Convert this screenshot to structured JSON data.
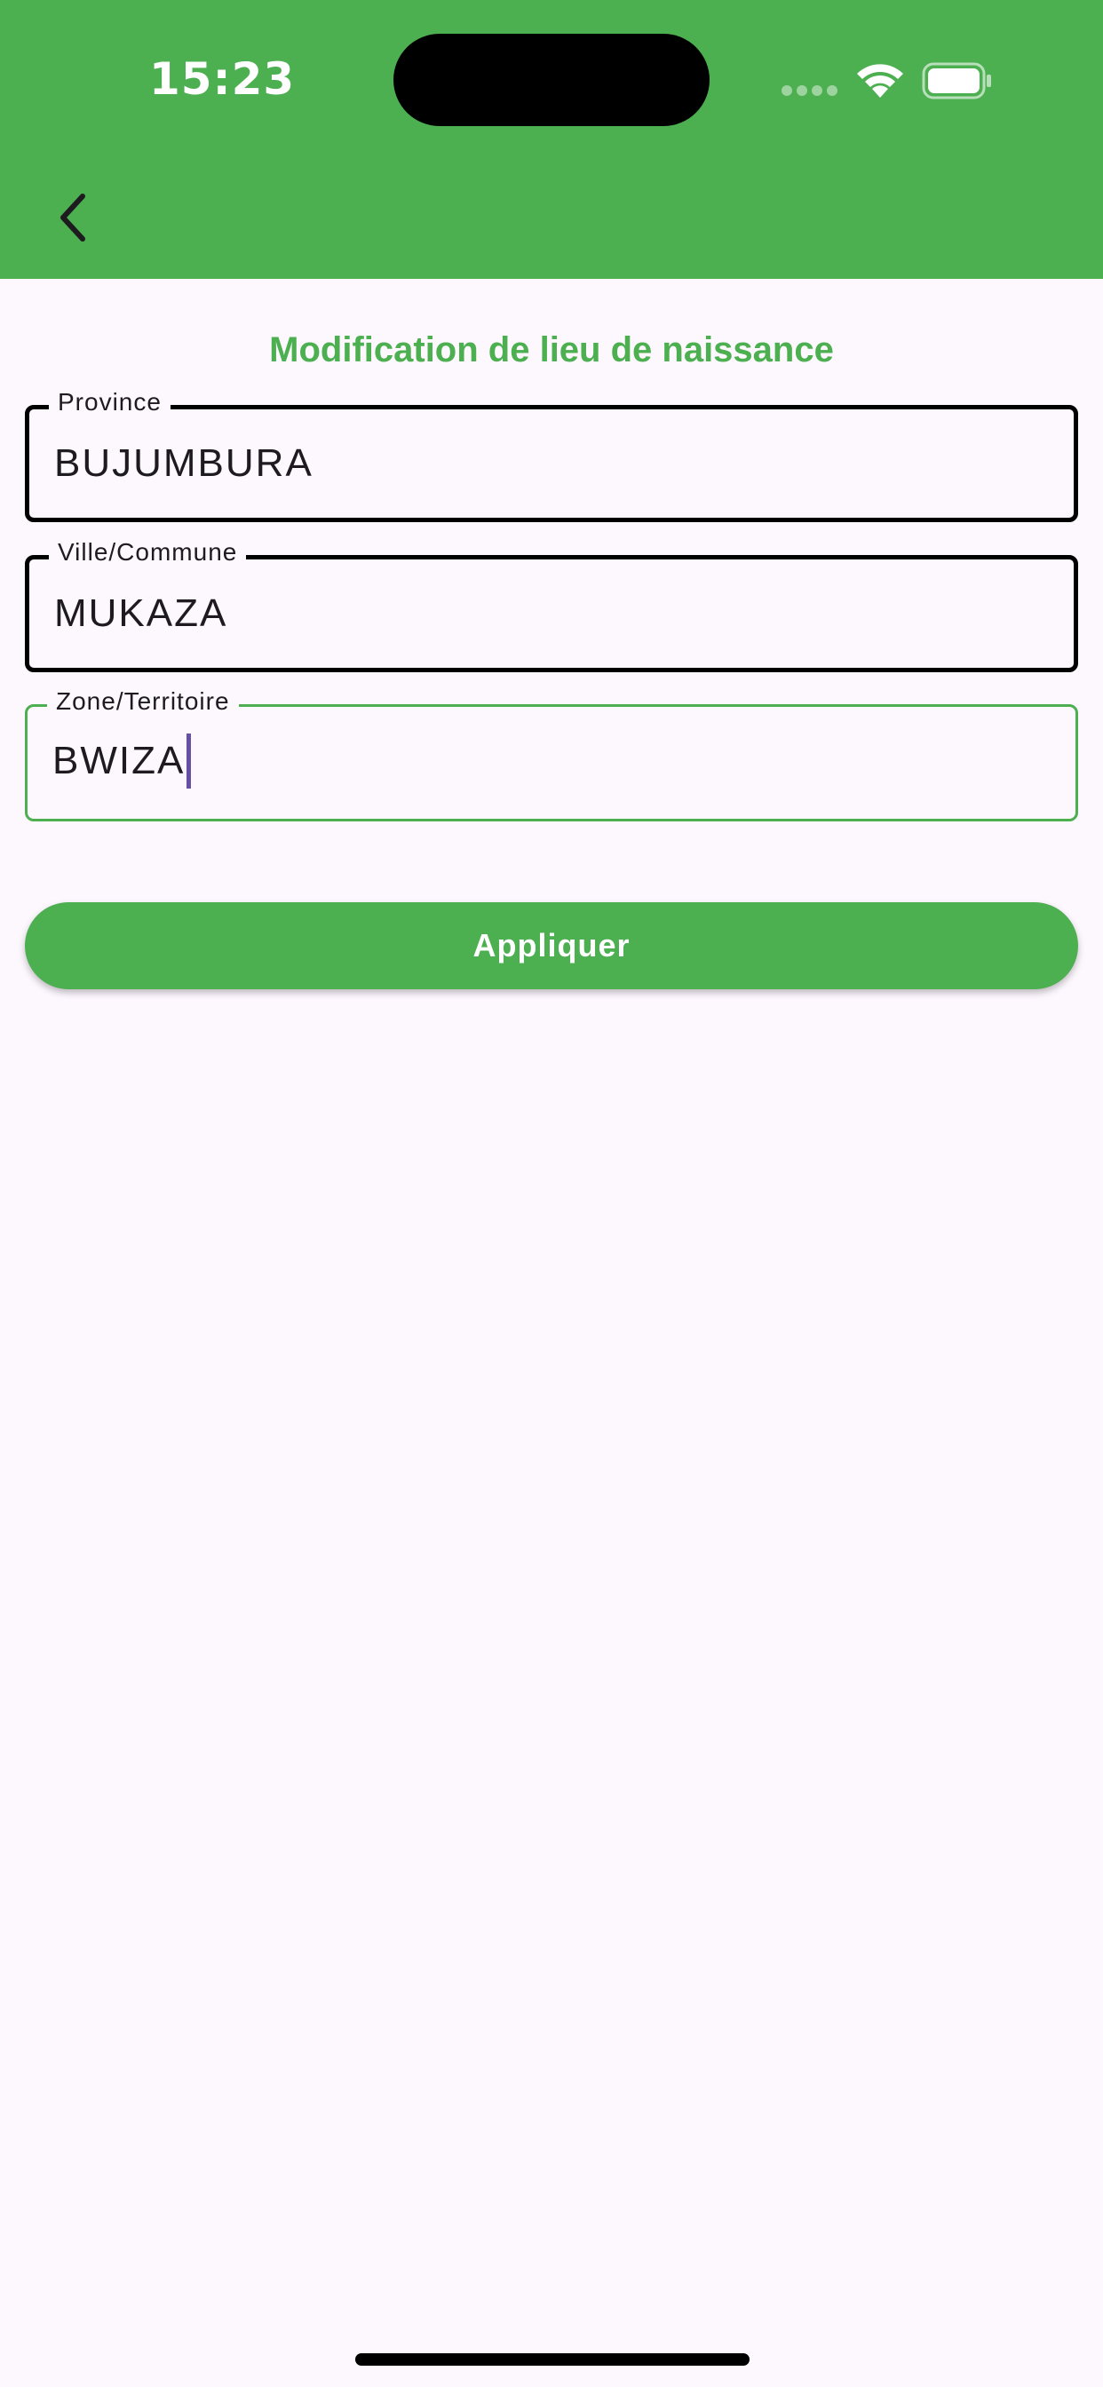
{
  "status_bar": {
    "time": "15:23"
  },
  "app_bar": {
    "background_color": "#4caf50",
    "back_icon": "chevron-left-icon"
  },
  "page": {
    "title": "Modification de lieu de naissance",
    "title_color": "#4caf50"
  },
  "form": {
    "province": {
      "label": "Province",
      "value": "BUJUMBURA"
    },
    "commune": {
      "label": "Ville/Commune",
      "value": "MUKAZA"
    },
    "zone": {
      "label": "Zone/Territoire",
      "value": "BWIZA",
      "focused": true
    }
  },
  "actions": {
    "apply_label": "Appliquer",
    "apply_color": "#4caf50"
  }
}
